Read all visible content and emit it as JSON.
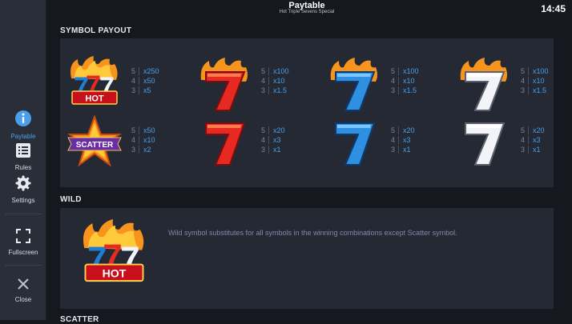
{
  "header": {
    "title": "Paytable",
    "subtitle": "Hot Triple Sevens Special",
    "clock": "14:45"
  },
  "sidebar": {
    "items": [
      {
        "label": "Paytable",
        "icon": "info-icon",
        "active": true
      },
      {
        "label": "Rules",
        "icon": "list-icon"
      },
      {
        "label": "Settings",
        "icon": "gear-icon"
      },
      {
        "label": "Fullscreen",
        "icon": "fullscreen-icon"
      },
      {
        "label": "Close",
        "icon": "close-icon"
      }
    ]
  },
  "symbol_payout": {
    "title": "SYMBOL PAYOUT",
    "symbols": [
      {
        "name": "hot-777",
        "badge": "HOT",
        "pays": [
          {
            "count": "5",
            "value": "x250"
          },
          {
            "count": "4",
            "value": "x50"
          },
          {
            "count": "3",
            "value": "x5"
          }
        ]
      },
      {
        "name": "red-seven-fire",
        "pays": [
          {
            "count": "5",
            "value": "x100"
          },
          {
            "count": "4",
            "value": "x10"
          },
          {
            "count": "3",
            "value": "x1.5"
          }
        ]
      },
      {
        "name": "blue-seven-fire",
        "pays": [
          {
            "count": "5",
            "value": "x100"
          },
          {
            "count": "4",
            "value": "x10"
          },
          {
            "count": "3",
            "value": "x1.5"
          }
        ]
      },
      {
        "name": "white-seven-fire",
        "pays": [
          {
            "count": "5",
            "value": "x100"
          },
          {
            "count": "4",
            "value": "x10"
          },
          {
            "count": "3",
            "value": "x1.5"
          }
        ]
      },
      {
        "name": "scatter-star",
        "badge": "SCATTER",
        "pays": [
          {
            "count": "5",
            "value": "x50"
          },
          {
            "count": "4",
            "value": "x10"
          },
          {
            "count": "3",
            "value": "x2"
          }
        ]
      },
      {
        "name": "red-seven",
        "pays": [
          {
            "count": "5",
            "value": "x20"
          },
          {
            "count": "4",
            "value": "x3"
          },
          {
            "count": "3",
            "value": "x1"
          }
        ]
      },
      {
        "name": "blue-seven",
        "pays": [
          {
            "count": "5",
            "value": "x20"
          },
          {
            "count": "4",
            "value": "x3"
          },
          {
            "count": "3",
            "value": "x1"
          }
        ]
      },
      {
        "name": "white-seven",
        "pays": [
          {
            "count": "5",
            "value": "x20"
          },
          {
            "count": "4",
            "value": "x3"
          },
          {
            "count": "3",
            "value": "x1"
          }
        ]
      }
    ]
  },
  "wild": {
    "title": "WILD",
    "badge": "HOT",
    "description": "Wild symbol substitutes for all symbols in the winning combinations except Scatter symbol."
  },
  "scatter": {
    "title": "SCATTER"
  },
  "colors": {
    "accent": "#4a9fe8",
    "panel": "#252934",
    "background": "#16181f",
    "sidebar": "#2a2e38"
  }
}
